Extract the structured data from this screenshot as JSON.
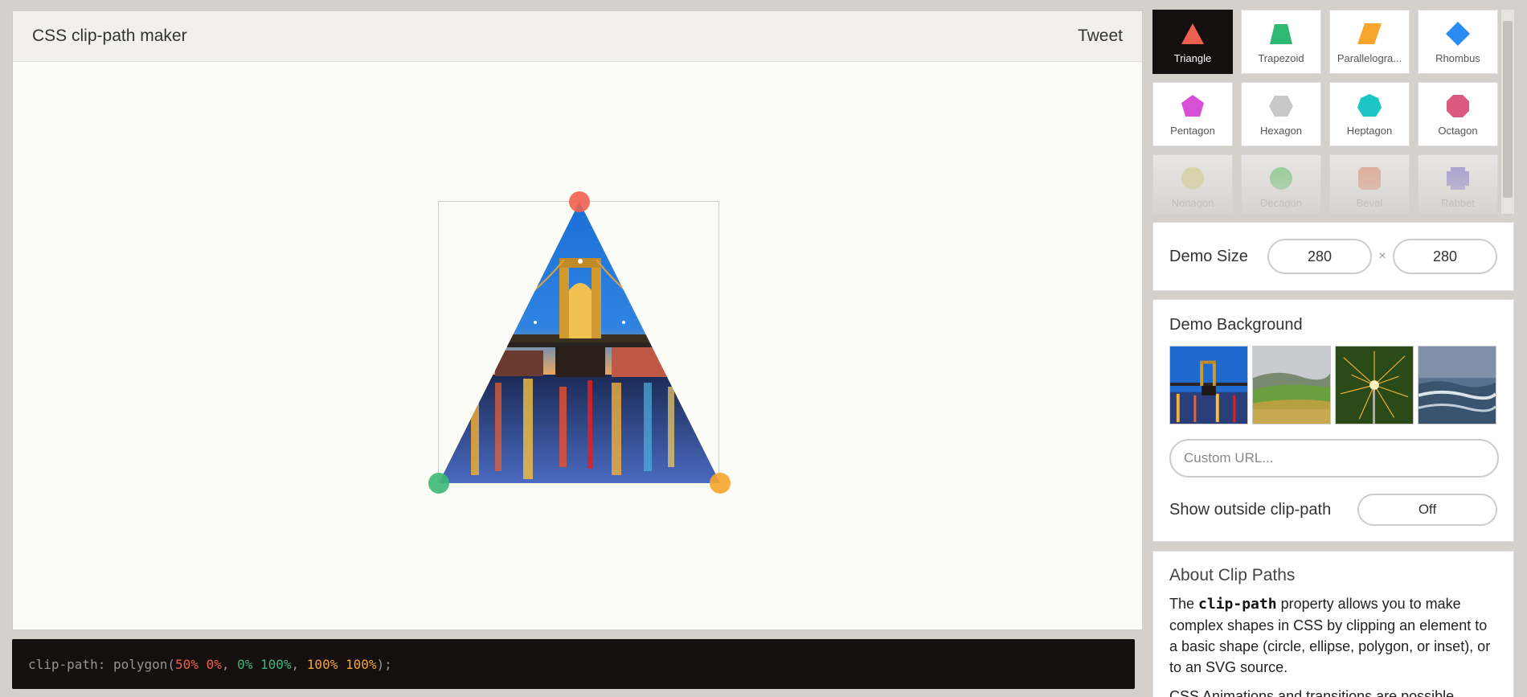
{
  "header": {
    "title": "CSS clip-path maker",
    "tweet_label": "Tweet"
  },
  "demo": {
    "handles": [
      {
        "point": "50% 0%",
        "color": "#f06050"
      },
      {
        "point": "0% 100%",
        "color": "#3cb878"
      },
      {
        "point": "100% 100%",
        "color": "#f7a52b"
      }
    ]
  },
  "code": {
    "prefix": "clip-path: polygon(",
    "p1": "50% 0%",
    "sep1": ", ",
    "p2": "0% 100%",
    "sep2": ", ",
    "p3": "100% 100%",
    "suffix": ");"
  },
  "shapes": [
    {
      "label": "Triangle",
      "icon": "triangle-icon",
      "color": "#f06050",
      "active": true
    },
    {
      "label": "Trapezoid",
      "icon": "trapezoid-icon",
      "color": "#2eb872"
    },
    {
      "label": "Parallelogra...",
      "icon": "parallelogram-icon",
      "color": "#f7a52b"
    },
    {
      "label": "Rhombus",
      "icon": "rhombus-icon",
      "color": "#2a8cf0"
    },
    {
      "label": "Pentagon",
      "icon": "pentagon-icon",
      "color": "#d64fd6"
    },
    {
      "label": "Hexagon",
      "icon": "hexagon-icon",
      "color": "#c8c8c8"
    },
    {
      "label": "Heptagon",
      "icon": "heptagon-icon",
      "color": "#1cc6c6"
    },
    {
      "label": "Octagon",
      "icon": "octagon-icon",
      "color": "#dc5a80"
    },
    {
      "label": "Nonagon",
      "icon": "nonagon-icon",
      "color": "#e3d66a"
    },
    {
      "label": "Decagon",
      "icon": "decagon-icon",
      "color": "#3cc84a"
    },
    {
      "label": "Bevel",
      "icon": "bevel-icon",
      "color": "#f07850"
    },
    {
      "label": "Rabbet",
      "icon": "rabbet-icon",
      "color": "#6a5cd6"
    }
  ],
  "demo_size": {
    "label": "Demo Size",
    "width": "280",
    "height": "280",
    "times": "×"
  },
  "demo_background": {
    "label": "Demo Background",
    "thumbnails": [
      "bridge-night-thumbnail",
      "green-hills-thumbnail",
      "sparkler-thumbnail",
      "ocean-waves-thumbnail"
    ],
    "custom_url_placeholder": "Custom URL...",
    "outside_label": "Show outside clip-path",
    "outside_value": "Off"
  },
  "about": {
    "title": "About Clip Paths",
    "text_before": "The ",
    "code_word": "clip-path",
    "text_after": " property allows you to make complex shapes in CSS by clipping an element to a basic shape (circle, ellipse, polygon, or inset), or to an SVG source.",
    "text2": "CSS Animations and transitions are possible"
  }
}
